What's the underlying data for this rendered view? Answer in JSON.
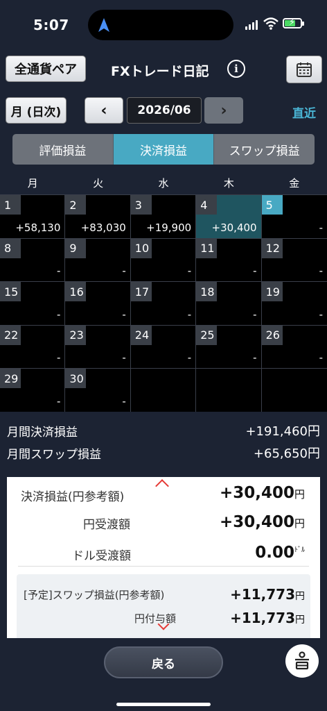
{
  "status": {
    "time": "5:07"
  },
  "header": {
    "currency_button": "全通貨ペア",
    "title": "FXトレード日記",
    "info_glyph": "i"
  },
  "nav": {
    "period_button": "月 (日次)",
    "prev": "‹",
    "month": "2026/06",
    "next": "›",
    "recent": "直近"
  },
  "tabs": [
    "評価損益",
    "決済損益",
    "スワップ損益"
  ],
  "active_tab": 1,
  "calendar": {
    "weekdays": [
      "月",
      "火",
      "水",
      "木",
      "金"
    ],
    "weeks": [
      [
        {
          "day": "1",
          "amount": "+58,130"
        },
        {
          "day": "2",
          "amount": "+83,030"
        },
        {
          "day": "3",
          "amount": "+19,900"
        },
        {
          "day": "4",
          "amount": "+30,400",
          "selected": true
        },
        {
          "day": "5",
          "amount": "-",
          "today": true
        }
      ],
      [
        {
          "day": "8",
          "amount": "-"
        },
        {
          "day": "9",
          "amount": "-"
        },
        {
          "day": "10",
          "amount": "-"
        },
        {
          "day": "11",
          "amount": "-"
        },
        {
          "day": "12",
          "amount": "-"
        }
      ],
      [
        {
          "day": "15",
          "amount": "-"
        },
        {
          "day": "16",
          "amount": "-"
        },
        {
          "day": "17",
          "amount": "-"
        },
        {
          "day": "18",
          "amount": "-"
        },
        {
          "day": "19",
          "amount": "-"
        }
      ],
      [
        {
          "day": "22",
          "amount": "-"
        },
        {
          "day": "23",
          "amount": "-"
        },
        {
          "day": "24",
          "amount": "-"
        },
        {
          "day": "25",
          "amount": "-"
        },
        {
          "day": "26",
          "amount": "-"
        }
      ],
      [
        {
          "day": "29",
          "amount": "-"
        },
        {
          "day": "30",
          "amount": "-"
        },
        null,
        null,
        null
      ]
    ]
  },
  "summary": {
    "monthly_settled_label": "月間決済損益",
    "monthly_settled_value": "+191,460円",
    "monthly_swap_label": "月間スワップ損益",
    "monthly_swap_value": "+65,650円"
  },
  "detail": {
    "settled_label": "決済損益(円参考額)",
    "settled_value": "+30,400",
    "settled_unit": "円",
    "yen_received_label": "円受渡額",
    "yen_received_value": "+30,400",
    "yen_received_unit": "円",
    "dollar_received_label": "ドル受渡額",
    "dollar_received_value": "0.00",
    "dollar_received_unit": "ﾄﾞﾙ",
    "swap_label": "[予定]スワップ損益(円参考額)",
    "swap_value": "+11,773",
    "swap_unit": "円",
    "yen_granted_label": "円付与額",
    "yen_granted_value": "+11,773",
    "yen_granted_unit": "円"
  },
  "footer": {
    "back_button": "戻る",
    "fab_glyph": "읍"
  },
  "colors": {
    "accent": "#48a9c3",
    "background": "#1c2333",
    "selected_cell": "#1f5560",
    "warning": "#e53935"
  }
}
